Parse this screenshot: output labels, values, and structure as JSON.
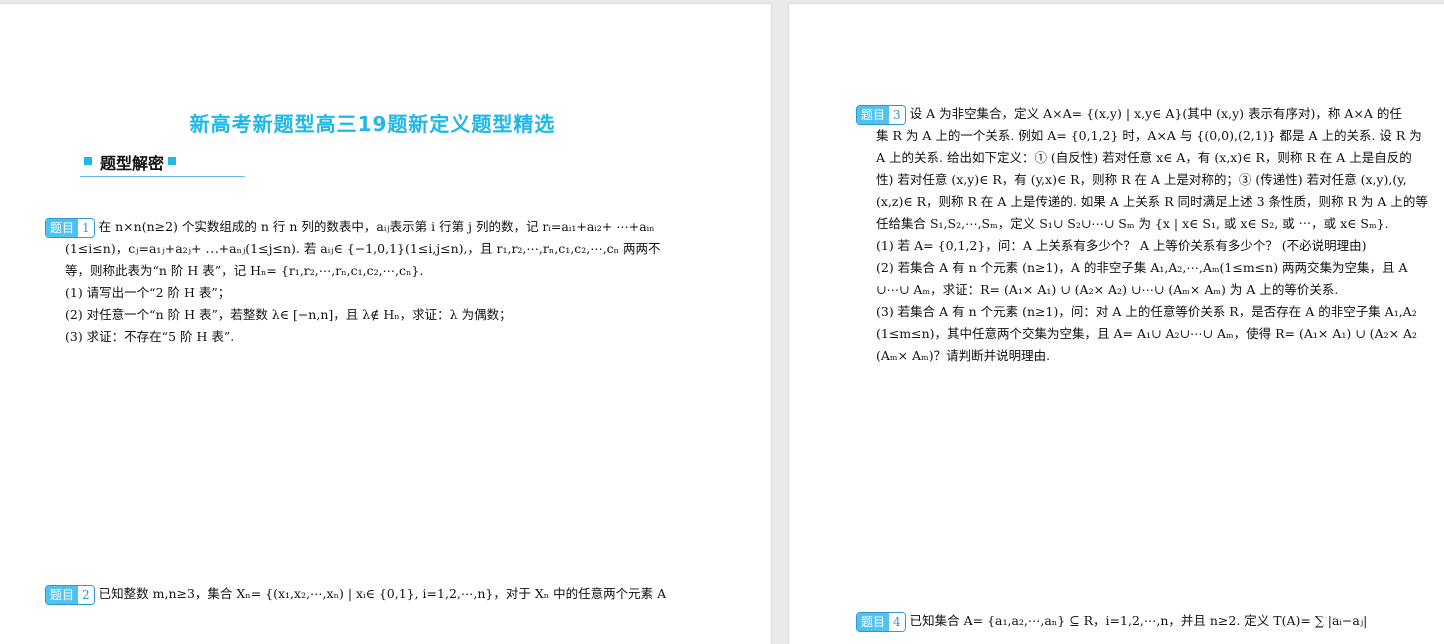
{
  "left_page": {
    "title": "新高考新题型高三19题新定义题型精选",
    "section": "题型解密",
    "problems": [
      {
        "tag": "题目",
        "number": "1",
        "lines": [
          "在 n×n(n≥2) 个实数组成的 n 行 n 列的数表中，aᵢⱼ表示第 i 行第 j 列的数，记 rᵢ=aᵢ₁+aᵢ₂+ ⋯+aᵢₙ",
          "(1≤i≤n)，cⱼ=a₁ⱼ+a₂ⱼ+ ⋯+aₙⱼ(1≤j≤n). 若 aᵢⱼ∈ {−1,0,1}(1≤i,j≤n),，且 r₁,r₂,⋯,rₙ,c₁,c₂,⋯,cₙ 两两不",
          "等，则称此表为“n 阶 H 表”，记 Hₙ= {r₁,r₂,⋯,rₙ,c₁,c₂,⋯,cₙ}.",
          "(1) 请写出一个“2 阶 H 表”；",
          "(2) 对任意一个“n 阶 H 表”，若整数 λ∈ [−n,n]，且 λ∉ Hₙ，求证：λ 为偶数；",
          "(3) 求证：不存在“5 阶 H 表”."
        ]
      },
      {
        "tag": "题目",
        "number": "2",
        "lines": [
          "已知整数 m,n≥3，集合 Xₙ= {(x₁,x₂,⋯,xₙ) | xᵢ∈ {0,1}, i=1,2,⋯,n}，对于 Xₙ 中的任意两个元素 A"
        ]
      }
    ]
  },
  "right_page": {
    "problems": [
      {
        "tag": "题目",
        "number": "3",
        "lines": [
          "设 A 为非空集合，定义 A×A= {(x,y) | x,y∈ A}(其中 (x,y) 表示有序对)，称 A×A 的任",
          "集 R 为 A 上的一个关系. 例如 A= {0,1,2} 时，A×A 与 {(0,0),(2,1)} 都是 A 上的关系. 设 R 为",
          "A 上的关系. 给出如下定义：① (自反性) 若对任意 x∈ A，有 (x,x)∈ R，则称 R 在 A 上是自反的",
          "性) 若对任意 (x,y)∈ R，有 (y,x)∈ R，则称 R 在 A 上是对称的；③ (传递性) 若对任意 (x,y),(y,",
          "(x,z)∈ R，则称 R 在 A 上是传递的. 如果 A 上关系 R 同时满足上述 3 条性质，则称 R 为 A 上的等",
          "任给集合 S₁,S₂,⋯,Sₘ，定义 S₁∪ S₂∪⋯∪ Sₘ 为 {x | x∈ S₁, 或 x∈ S₂, 或 ⋯，或 x∈ Sₘ}.",
          "(1) 若 A= {0,1,2}，问：A 上关系有多少个？ A 上等价关系有多少个？ (不必说明理由)",
          "(2) 若集合 A 有 n 个元素 (n≥1)，A 的非空子集 A₁,A₂,⋯,Aₘ(1≤m≤n) 两两交集为空集，且 A",
          "∪⋯∪ Aₘ，求证：R= (A₁× A₁) ∪ (A₂× A₂) ∪⋯∪ (Aₘ× Aₘ) 为 A 上的等价关系.",
          "(3) 若集合 A 有 n 个元素 (n≥1)，问：对 A 上的任意等价关系 R，是否存在 A 的非空子集 A₁,A₂",
          "(1≤m≤n)，其中任意两个交集为空集，且 A= A₁∪ A₂∪⋯∪ Aₘ，使得 R= (A₁× A₁) ∪ (A₂× A₂",
          "(Aₘ× Aₘ)？请判断并说明理由."
        ]
      },
      {
        "tag": "题目",
        "number": "4",
        "lines": [
          "已知集合 A= {a₁,a₂,⋯,aₙ} ⊆ R，i=1,2,⋯,n，并且 n≥2. 定义 T(A)= ∑ |aᵢ−aⱼ|"
        ]
      }
    ]
  },
  "colors": {
    "title": "#1fb8e8",
    "tag_fill": "#4ec3ef",
    "tag_border": "#2f97d6",
    "section_rule": "#6fb3e0"
  }
}
